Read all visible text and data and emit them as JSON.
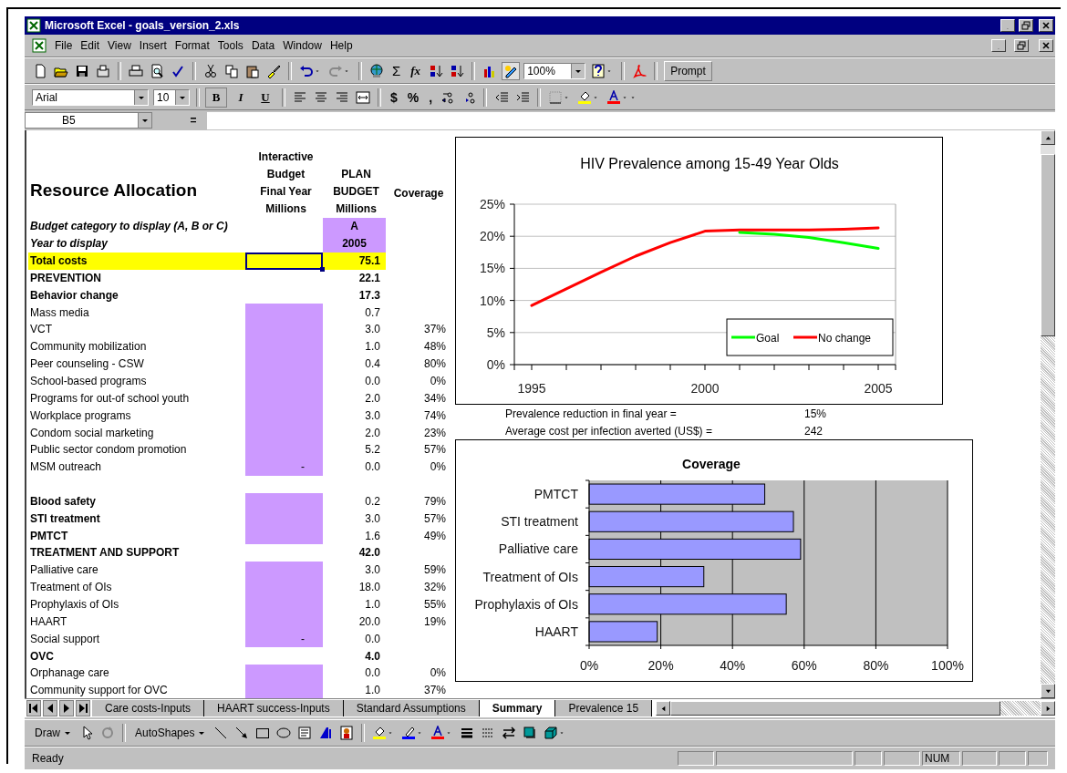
{
  "window": {
    "title": "Microsoft Excel - goals_version_2.xls"
  },
  "menu": [
    {
      "label": "File"
    },
    {
      "label": "Edit"
    },
    {
      "label": "View"
    },
    {
      "label": "Insert"
    },
    {
      "label": "Format"
    },
    {
      "label": "Tools"
    },
    {
      "label": "Data"
    },
    {
      "label": "Window"
    },
    {
      "label": "Help"
    }
  ],
  "standard_toolbar": {
    "sum": "Σ",
    "function": "fx",
    "zoom": "100%",
    "prompt": "Prompt"
  },
  "format_toolbar": {
    "font": "Arial",
    "size": "10",
    "styles": [
      {
        "label": "B",
        "pressed": true
      },
      {
        "label": "I",
        "pressed": false
      },
      {
        "label": "U",
        "pressed": false
      }
    ],
    "currency": "$",
    "percent": "%",
    "comma": ","
  },
  "formula_bar": {
    "cell": "B5",
    "equals": "="
  },
  "sheet": {
    "title": "Resource Allocation",
    "headers": [
      "Interactive\nBudget\nFinal Year\nMillions",
      "PLAN\nBUDGET\nMillions",
      "Coverage"
    ],
    "rows": [
      {
        "kind": "param",
        "label": "Budget category to display (A, B or C)",
        "input": false,
        "selected": false,
        "plan": "A"
      },
      {
        "kind": "param",
        "label": "Year to display",
        "input": false,
        "selected": false,
        "plan": "2005"
      },
      {
        "kind": "total",
        "label": "Total costs",
        "input": false,
        "selected": true,
        "plan": "75.1"
      },
      {
        "kind": "section",
        "label": "PREVENTION",
        "input": false,
        "selected": false,
        "plan": "22.1"
      },
      {
        "kind": "section",
        "label": "Behavior change",
        "input": false,
        "selected": false,
        "plan": "17.3"
      },
      {
        "kind": "item",
        "label": "Mass media",
        "input": true,
        "selected": false,
        "plan": "0.7"
      },
      {
        "kind": "item",
        "label": "VCT",
        "input": true,
        "selected": false,
        "plan": "3.0",
        "coverage": "37%"
      },
      {
        "kind": "item",
        "label": "Community mobilization",
        "input": true,
        "selected": false,
        "plan": "1.0",
        "coverage": "48%"
      },
      {
        "kind": "item",
        "label": "Peer counseling - CSW",
        "input": true,
        "selected": false,
        "plan": "0.4",
        "coverage": "80%"
      },
      {
        "kind": "item",
        "label": "School-based programs",
        "input": true,
        "selected": false,
        "plan": "0.0",
        "coverage": "0%"
      },
      {
        "kind": "item",
        "label": "Programs for out-of school youth",
        "input": true,
        "selected": false,
        "plan": "2.0",
        "coverage": "34%"
      },
      {
        "kind": "item",
        "label": "Workplace programs",
        "input": true,
        "selected": false,
        "plan": "3.0",
        "coverage": "74%"
      },
      {
        "kind": "item",
        "label": "Condom social marketing",
        "input": true,
        "selected": false,
        "plan": "2.0",
        "coverage": "23%"
      },
      {
        "kind": "item",
        "label": "Public sector condom promotion",
        "input": true,
        "selected": false,
        "plan": "5.2",
        "coverage": "57%"
      },
      {
        "kind": "item",
        "label": "MSM outreach",
        "input": true,
        "input_value": "-",
        "selected": false,
        "plan": "0.0",
        "coverage": "0%"
      },
      {
        "kind": "blank",
        "input": false,
        "selected": false
      },
      {
        "kind": "program",
        "label": "Blood safety",
        "input": true,
        "selected": false,
        "plan": "0.2",
        "coverage": "79%"
      },
      {
        "kind": "program",
        "label": "STI treatment",
        "input": true,
        "selected": false,
        "plan": "3.0",
        "coverage": "57%"
      },
      {
        "kind": "program",
        "label": "PMTCT",
        "input": true,
        "selected": false,
        "plan": "1.6",
        "coverage": "49%"
      },
      {
        "kind": "section",
        "label": "TREATMENT AND SUPPORT",
        "input": false,
        "selected": false,
        "plan": "42.0"
      },
      {
        "kind": "item",
        "label": "Palliative care",
        "input": true,
        "selected": false,
        "plan": "3.0",
        "coverage": "59%"
      },
      {
        "kind": "item",
        "label": "Treatment of OIs",
        "input": true,
        "selected": false,
        "plan": "18.0",
        "coverage": "32%"
      },
      {
        "kind": "item",
        "label": "Prophylaxis of OIs",
        "input": true,
        "selected": false,
        "plan": "1.0",
        "coverage": "55%"
      },
      {
        "kind": "item",
        "label": "HAART",
        "input": true,
        "selected": false,
        "plan": "20.0",
        "coverage": "19%"
      },
      {
        "kind": "item",
        "label": "Social support",
        "input": true,
        "input_value": "-",
        "selected": false,
        "plan": "0.0"
      },
      {
        "kind": "section",
        "label": "OVC",
        "input": false,
        "selected": false,
        "plan": "4.0"
      },
      {
        "kind": "item",
        "label": "Orphanage care",
        "input": true,
        "selected": false,
        "plan": "0.0",
        "coverage": "0%"
      },
      {
        "kind": "item",
        "label": "Community support for OVC",
        "input": true,
        "selected": false,
        "plan": "1.0",
        "coverage": "37%"
      }
    ]
  },
  "prevalence_chart": {
    "chart_data": {
      "type": "line",
      "title": "HIV Prevalence among 15-49 Year Olds",
      "x": [
        1995,
        1996,
        1997,
        1998,
        1999,
        2000,
        2001,
        2002,
        2003,
        2004,
        2005
      ],
      "xlim": [
        1994.5,
        2005.5
      ],
      "xticks": [
        1995,
        2000,
        2005
      ],
      "grid": "y",
      "legend": "bottom-right",
      "ylim": [
        0,
        25
      ],
      "yticks": [
        {
          "value": 0,
          "label": "0%"
        },
        {
          "value": 5,
          "label": "5%"
        },
        {
          "value": 10,
          "label": "10%"
        },
        {
          "value": 15,
          "label": "15%"
        },
        {
          "value": 20,
          "label": "20%"
        },
        {
          "value": 25,
          "label": "25%"
        }
      ],
      "series": [
        {
          "name": "Goal",
          "color": "#00ff00",
          "values": [
            null,
            null,
            null,
            null,
            null,
            null,
            20.6,
            20.3,
            19.8,
            19.0,
            18.1
          ]
        },
        {
          "name": "No change",
          "color": "#ff0000",
          "values": [
            9.2,
            11.8,
            14.4,
            16.9,
            19.0,
            20.8,
            21.0,
            21.0,
            21.0,
            21.1,
            21.3
          ]
        }
      ]
    }
  },
  "stats": [
    {
      "label": "Prevalence reduction in final year =",
      "value": "15%"
    },
    {
      "label": "Average cost per infection averted (US$) =",
      "value": "242"
    }
  ],
  "coverage_chart": {
    "chart_data": {
      "type": "bar",
      "orientation": "horizontal",
      "grid": "x",
      "title": "Coverage",
      "categories": [
        "PMTCT",
        "STI treatment",
        "Palliative care",
        "Treatment of OIs",
        "Prophylaxis of OIs",
        "HAART"
      ],
      "xlim": [
        0,
        100
      ],
      "xticks": [
        {
          "value": 0,
          "label": "0%"
        },
        {
          "value": 20,
          "label": "20%"
        },
        {
          "value": 40,
          "label": "40%"
        },
        {
          "value": 60,
          "label": "60%"
        },
        {
          "value": 80,
          "label": "80%"
        },
        {
          "value": 100,
          "label": "100%"
        }
      ],
      "series": [
        {
          "color": "#9999ff",
          "values": [
            49,
            57,
            59,
            32,
            55,
            19
          ]
        }
      ]
    }
  },
  "sheet_tabs": [
    {
      "label": "Care costs-Inputs",
      "selected": false
    },
    {
      "label": "HAART success-Inputs",
      "selected": false
    },
    {
      "label": "Standard Assumptions",
      "selected": false
    },
    {
      "label": "Summary",
      "selected": true
    },
    {
      "label": "Prevalence 15",
      "selected": false
    }
  ],
  "draw_toolbar": {
    "draw": "Draw",
    "autoshapes": "AutoShapes"
  },
  "status_bar": {
    "text": "Ready",
    "indicator": "NUM"
  }
}
